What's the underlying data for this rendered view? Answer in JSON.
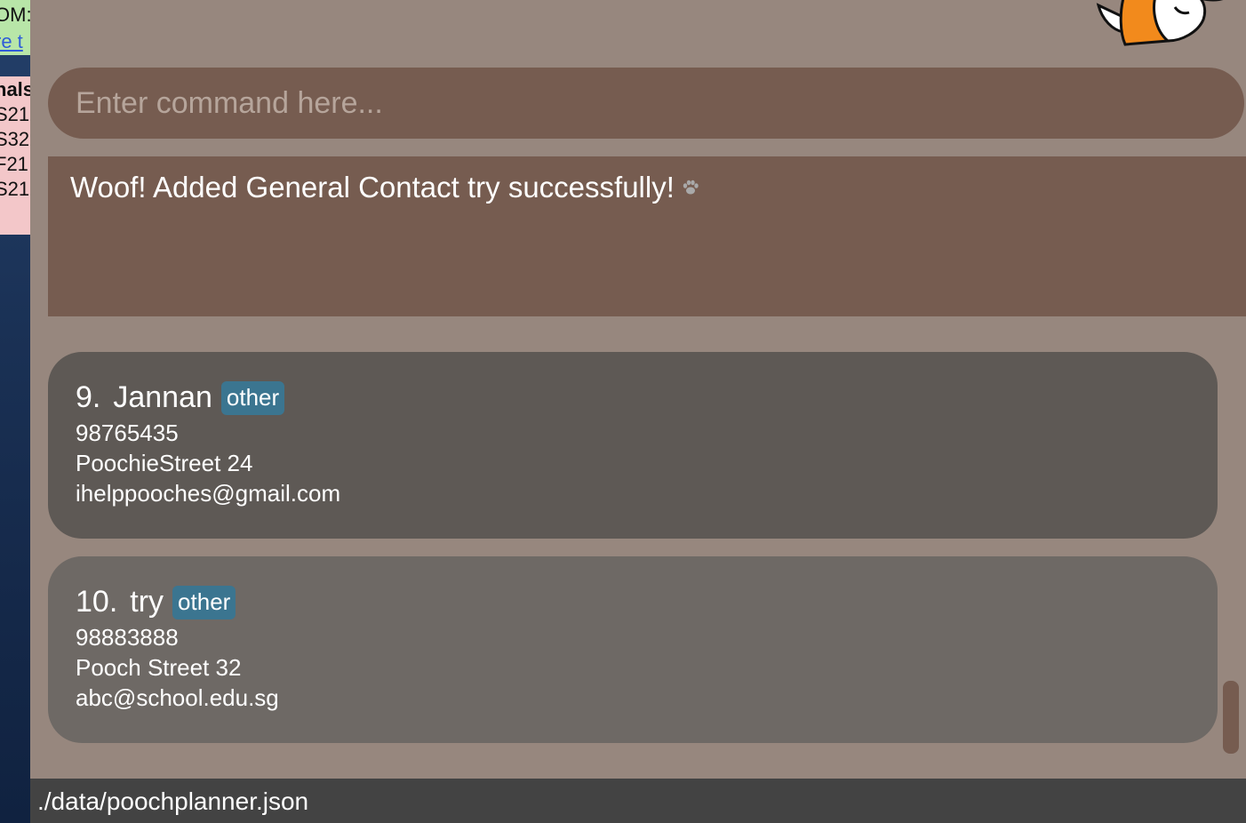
{
  "background": {
    "note_green_lines": [
      "OM:",
      "re t"
    ],
    "note_pink_lines": [
      "nals",
      "S21",
      "S32",
      "F21",
      "S21"
    ]
  },
  "command": {
    "placeholder": "Enter command here...",
    "value": ""
  },
  "result": {
    "message": "Woof! Added General Contact try successfully!"
  },
  "contacts": [
    {
      "index": "9.",
      "name": "Jannan",
      "tag": "other",
      "phone": "98765435",
      "address": "PoochieStreet 24",
      "email": "ihelppooches@gmail.com"
    },
    {
      "index": "10.",
      "name": "try",
      "tag": "other",
      "phone": "98883888",
      "address": "Pooch Street 32",
      "email": "abc@school.edu.sg"
    }
  ],
  "status": {
    "file_path": "./data/poochplanner.json"
  },
  "colors": {
    "app_background": "#97877e",
    "box_brown": "#765c50",
    "card_selected": "#5e5955",
    "card": "#6e6965",
    "tag": "#3b7590",
    "status_bar": "#434343"
  },
  "icons": [
    "paw-icon",
    "dog-mascot-icon"
  ]
}
